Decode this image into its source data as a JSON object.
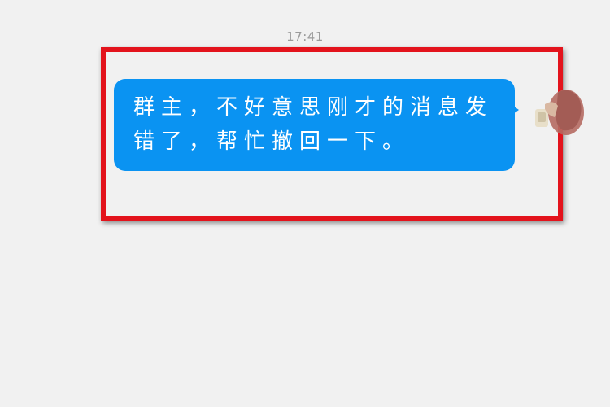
{
  "chat": {
    "timestamp": "17:41",
    "message": {
      "text": "群主，不好意思刚才的消息发错了，帮忙撤回一下。",
      "direction": "outgoing",
      "bubble_color": "#0a93f2",
      "text_color": "#ffffff"
    },
    "highlight_color": "#e3131c",
    "avatar_icon": "user-avatar"
  }
}
